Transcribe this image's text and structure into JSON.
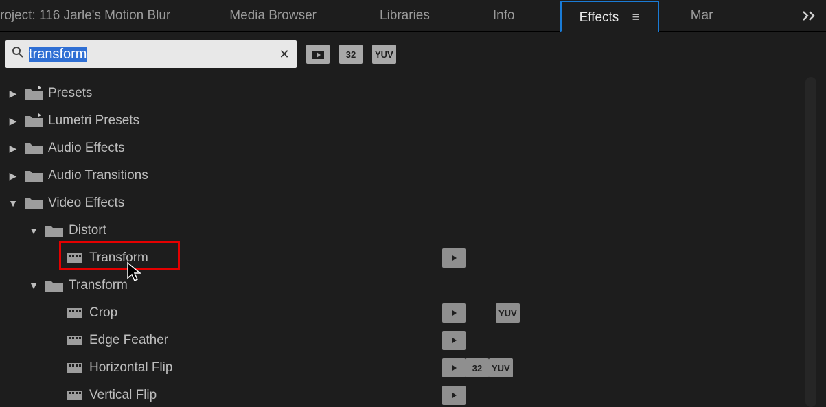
{
  "tabs": {
    "project": "roject: 116 Jarle's Motion Blur",
    "media_browser": "Media Browser",
    "libraries": "Libraries",
    "info": "Info",
    "effects": "Effects",
    "mar": "Mar"
  },
  "search": {
    "value": "transform"
  },
  "toolbar_badges": {
    "accel": "",
    "bit32": "32",
    "yuv": "YUV"
  },
  "tree": {
    "presets": "Presets",
    "lumetri": "Lumetri Presets",
    "audio_fx": "Audio Effects",
    "audio_trans": "Audio Transitions",
    "video_fx": "Video Effects",
    "distort": "Distort",
    "transform_fx": "Transform",
    "transform_folder": "Transform",
    "crop": "Crop",
    "edge_feather": "Edge Feather",
    "hflip": "Horizontal Flip",
    "vflip": "Vertical Flip"
  }
}
